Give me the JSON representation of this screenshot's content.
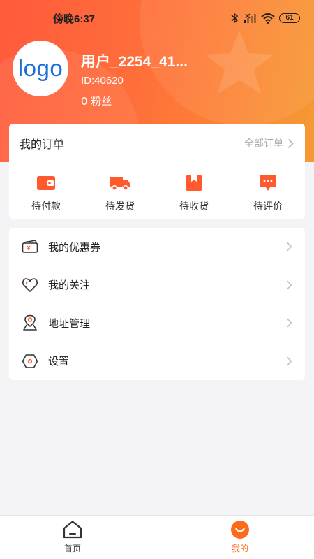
{
  "status_bar": {
    "time": "傍晚6:37",
    "battery": "61",
    "icons": [
      "bluetooth-icon",
      "signal-icon",
      "wifi-icon",
      "battery-icon"
    ]
  },
  "profile": {
    "avatar_text": "logo",
    "username": "用户_2254_41...",
    "user_id": "ID:40620",
    "fans": "0 粉丝"
  },
  "orders": {
    "title": "我的订单",
    "all_label": "全部订单",
    "items": [
      {
        "label": "待付款",
        "icon": "wallet-icon"
      },
      {
        "label": "待发货",
        "icon": "truck-icon"
      },
      {
        "label": "待收货",
        "icon": "package-icon"
      },
      {
        "label": "待评价",
        "icon": "comment-icon"
      }
    ]
  },
  "menu": {
    "items": [
      {
        "label": "我的优惠券",
        "icon": "coupon-icon"
      },
      {
        "label": "我的关注",
        "icon": "heart-icon"
      },
      {
        "label": "地址管理",
        "icon": "location-icon"
      },
      {
        "label": "设置",
        "icon": "settings-icon"
      }
    ]
  },
  "tab_bar": {
    "tabs": [
      {
        "label": "首页",
        "icon": "home-icon",
        "active": false
      },
      {
        "label": "我的",
        "icon": "mine-icon",
        "active": true
      }
    ]
  },
  "colors": {
    "accent": "#ff5a2e",
    "gradient_start": "#ff5a3c",
    "gradient_end": "#f59a33",
    "tab_active": "#ff6a1a",
    "tab_inactive": "#444444"
  }
}
